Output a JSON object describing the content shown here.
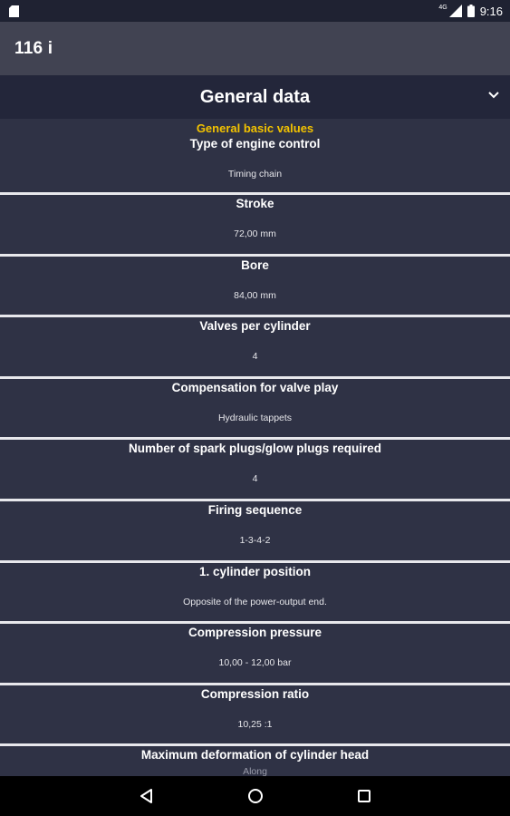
{
  "status_bar": {
    "network_label": "4G",
    "time": "9:16",
    "icons": [
      "sd-card-icon",
      "signal-icon",
      "battery-icon"
    ]
  },
  "app_bar": {
    "title": "116 i"
  },
  "section": {
    "title": "General data",
    "expand_icon": "chevron-down-icon"
  },
  "group": {
    "title": "General basic values"
  },
  "rows": [
    {
      "label": "Type of engine control",
      "value": "Timing chain"
    },
    {
      "label": "Stroke",
      "value": "72,00 mm"
    },
    {
      "label": "Bore",
      "value": "84,00 mm"
    },
    {
      "label": "Valves per cylinder",
      "value": "4"
    },
    {
      "label": "Compensation for valve play",
      "value": "Hydraulic tappets"
    },
    {
      "label": "Number of spark plugs/glow plugs required",
      "value": "4"
    },
    {
      "label": "Firing sequence",
      "value": "1-3-4-2"
    },
    {
      "label": "1. cylinder position",
      "value": "Opposite of the power-output end."
    },
    {
      "label": "Compression pressure",
      "value": "10,00 - 12,00 bar"
    },
    {
      "label": "Compression ratio",
      "value": "10,25 :1"
    },
    {
      "label": "Maximum deformation of cylinder head",
      "value": "Along"
    }
  ],
  "nav_bar": {
    "icons": [
      "back-icon",
      "home-icon",
      "recents-icon"
    ]
  },
  "colors": {
    "background": "#2f3245",
    "app_bar": "#414352",
    "section_header": "#23263a",
    "group_title": "#f2c200",
    "divider": "#e8e8ec"
  }
}
